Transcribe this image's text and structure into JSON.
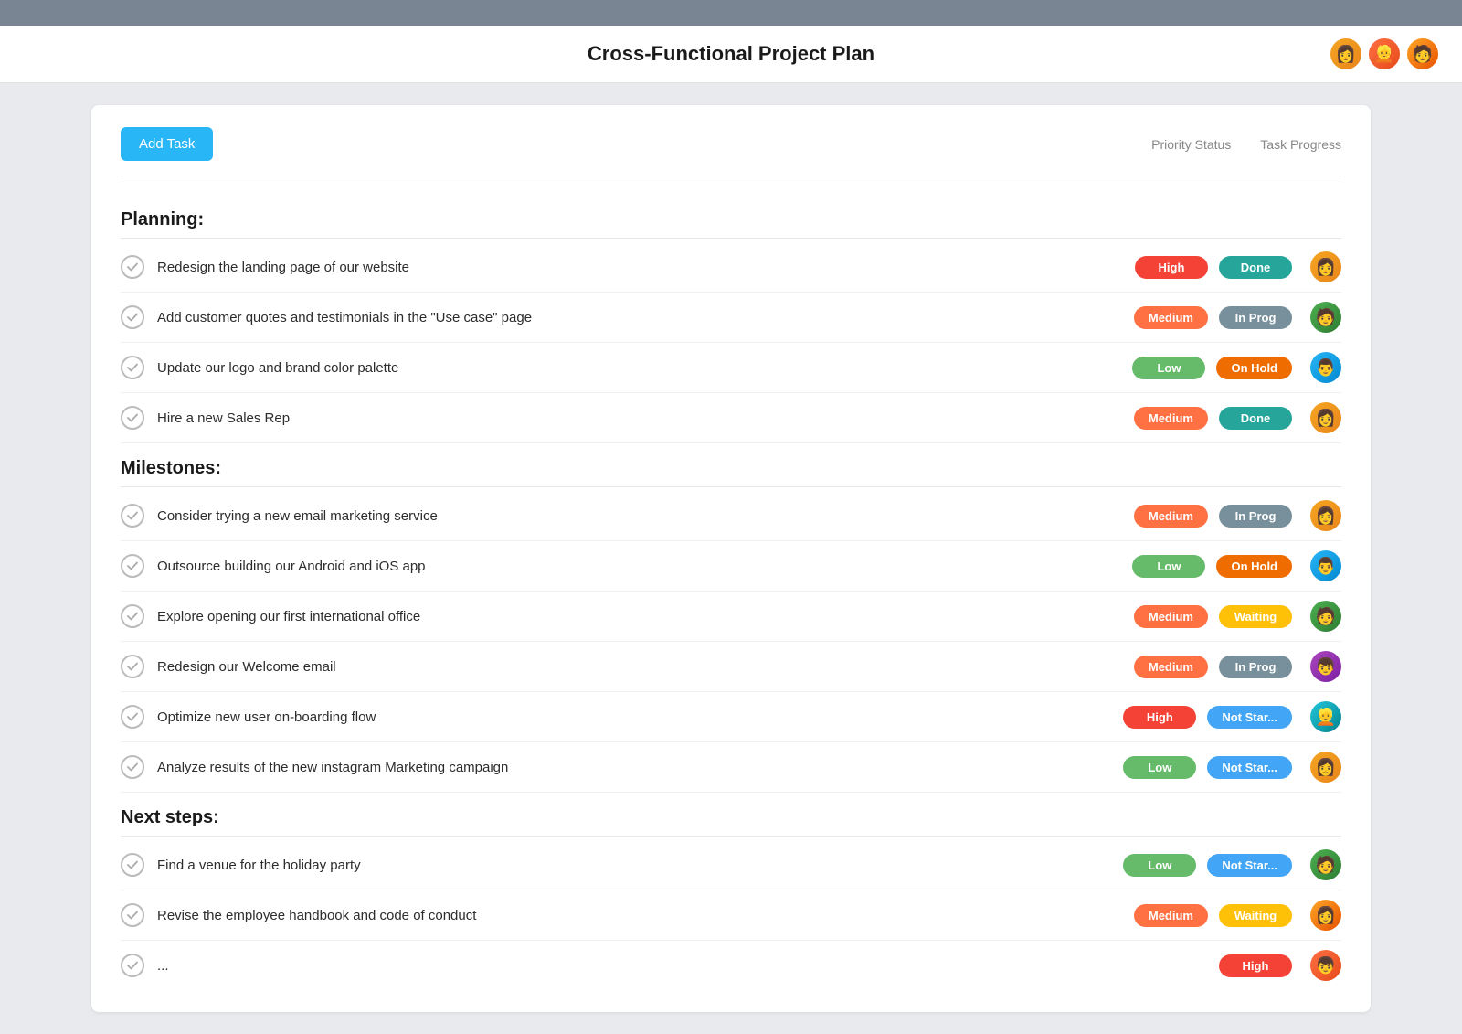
{
  "topBar": {},
  "header": {
    "title": "Cross-Functional Project Plan",
    "avatars": [
      {
        "id": "av1",
        "emoji": "👩",
        "colorClass": "av1"
      },
      {
        "id": "av2",
        "emoji": "👱",
        "colorClass": "av4"
      },
      {
        "id": "av3",
        "emoji": "🧑",
        "colorClass": "av7"
      }
    ]
  },
  "toolbar": {
    "addTaskLabel": "Add Task",
    "col1Label": "Priority Status",
    "col2Label": "Task Progress"
  },
  "sections": [
    {
      "id": "planning",
      "title": "Planning:",
      "tasks": [
        {
          "id": "t1",
          "name": "Redesign the landing page of our website",
          "priority": "High",
          "priorityClass": "priority-high",
          "status": "Done",
          "statusClass": "status-done",
          "avatarClass": "av1",
          "avatarEmoji": "👩"
        },
        {
          "id": "t2",
          "name": "Add customer quotes and testimonials in the \"Use case\" page",
          "priority": "Medium",
          "priorityClass": "priority-medium",
          "status": "In Prog",
          "statusClass": "status-inprog",
          "avatarClass": "av2",
          "avatarEmoji": "🧑"
        },
        {
          "id": "t3",
          "name": "Update our logo and brand color palette",
          "priority": "Low",
          "priorityClass": "priority-low",
          "status": "On Hold",
          "statusClass": "status-onhold",
          "avatarClass": "av3",
          "avatarEmoji": "👨"
        },
        {
          "id": "t4",
          "name": "Hire a new Sales Rep",
          "priority": "Medium",
          "priorityClass": "priority-medium",
          "status": "Done",
          "statusClass": "status-done",
          "avatarClass": "av1",
          "avatarEmoji": "👩"
        }
      ]
    },
    {
      "id": "milestones",
      "title": "Milestones:",
      "tasks": [
        {
          "id": "t5",
          "name": "Consider trying a new email marketing service",
          "priority": "Medium",
          "priorityClass": "priority-medium",
          "status": "In Prog",
          "statusClass": "status-inprog",
          "avatarClass": "av1",
          "avatarEmoji": "👩"
        },
        {
          "id": "t6",
          "name": "Outsource building our Android and iOS app",
          "priority": "Low",
          "priorityClass": "priority-low",
          "status": "On Hold",
          "statusClass": "status-onhold",
          "avatarClass": "av3",
          "avatarEmoji": "👨"
        },
        {
          "id": "t7",
          "name": "Explore opening our first international office",
          "priority": "Medium",
          "priorityClass": "priority-medium",
          "status": "Waiting",
          "statusClass": "status-waiting",
          "avatarClass": "av2",
          "avatarEmoji": "🧑"
        },
        {
          "id": "t8",
          "name": "Redesign our Welcome email",
          "priority": "Medium",
          "priorityClass": "priority-medium",
          "status": "In Prog",
          "statusClass": "status-inprog",
          "avatarClass": "av5",
          "avatarEmoji": "👦"
        },
        {
          "id": "t9",
          "name": "Optimize new user on-boarding flow",
          "priority": "High",
          "priorityClass": "priority-high",
          "status": "Not Star...",
          "statusClass": "status-notstart",
          "avatarClass": "av6",
          "avatarEmoji": "👱"
        },
        {
          "id": "t10",
          "name": "Analyze results of the new instagram Marketing campaign",
          "priority": "Low",
          "priorityClass": "priority-low",
          "status": "Not Star...",
          "statusClass": "status-notstart",
          "avatarClass": "av1",
          "avatarEmoji": "👩"
        }
      ]
    },
    {
      "id": "nextsteps",
      "title": "Next steps:",
      "tasks": [
        {
          "id": "t11",
          "name": "Find a venue for the holiday party",
          "priority": "Low",
          "priorityClass": "priority-low",
          "status": "Not Star...",
          "statusClass": "status-notstart",
          "avatarClass": "av2",
          "avatarEmoji": "🧑"
        },
        {
          "id": "t12",
          "name": "Revise the employee handbook and code of conduct",
          "priority": "Medium",
          "priorityClass": "priority-medium",
          "status": "Waiting",
          "statusClass": "status-waiting",
          "avatarClass": "av7",
          "avatarEmoji": "👩"
        },
        {
          "id": "t13",
          "name": "...",
          "priority": "High",
          "priorityClass": "priority-high",
          "status": "",
          "statusClass": "",
          "avatarClass": "av4",
          "avatarEmoji": "👦"
        }
      ]
    }
  ]
}
